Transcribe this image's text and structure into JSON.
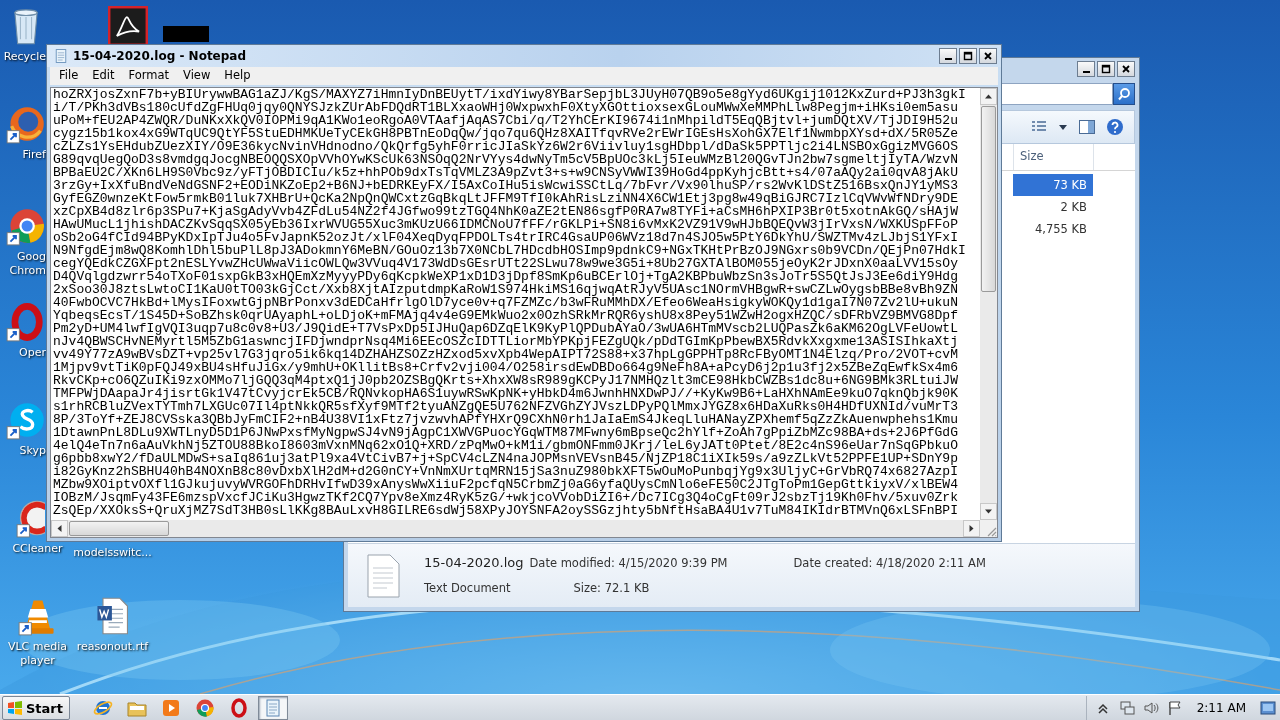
{
  "desktop": {
    "icons": [
      {
        "kind": "recycle",
        "label": "Recycle",
        "shortcut": false
      },
      {
        "kind": "acrobat",
        "shortcut": false
      },
      {
        "kind": "blank",
        "shortcut": false
      },
      {
        "kind": "firefox",
        "label": "Firef",
        "shortcut": true
      },
      {
        "kind": "chrome",
        "label": "Goog\nChrom",
        "shortcut": true
      },
      {
        "kind": "opera",
        "label": "Oper",
        "shortcut": true
      },
      {
        "kind": "skype",
        "label": "Skyp",
        "shortcut": true
      },
      {
        "kind": "ccleaner",
        "label": "CCleaner",
        "shortcut": true
      },
      {
        "kind": "none",
        "label": "modelsswitc..."
      },
      {
        "kind": "vlc",
        "label": "VLC media player",
        "shortcut": true
      },
      {
        "kind": "word",
        "label": "reasonout.rtf",
        "shortcut": false
      }
    ]
  },
  "explorer": {
    "columns": [
      {
        "label": "Size"
      }
    ],
    "rows": [
      {
        "size": "73 KB",
        "selected": true
      },
      {
        "size": "2 KB",
        "selected": false
      },
      {
        "size": "4,755 KB",
        "selected": false
      }
    ],
    "details": {
      "name": "15-04-2020.log",
      "date_modified": "Date modified: 4/15/2020 9:39 PM",
      "date_created": "Date created: 4/18/2020 2:11 AM",
      "type": "Text Document",
      "size": "Size: 72.1 KB"
    }
  },
  "notepad": {
    "title": "15-04-2020.log - Notepad",
    "menu": [
      "File",
      "Edit",
      "Format",
      "View",
      "Help"
    ],
    "lines": [
      "hoZRXjosZxnF7b+yBIUrywwBAG1aZJ/KgS/MAXYZ7iHmnIyDnBEUytT/ixdYiwy8YBarSepjbL3JUyH07QB9o5e8gYyd6UKgij1012KxZurd+PJ3h3gkI",
      "i/T/PKh3dVBs180cUfdZgFHUq0jqy0QNYSJzkZUrAbFDQdRT1BLXxaoWHj0WxpwxhF0XtyXGOttioxsexGLouMWwXeMMPhLlw8Pegjm+iHKsi0em5asu",
      "uPoM+fEU2AP4ZWQR/DuNKxXkQV0IOPMi9qA1KWo1eoRgoA0VTAafjAqAS7Cbi/q/T2YhCErKI9674i1nMhpildT5EqQBjtvl+jumDQtXV/TjJDI9H52u",
      "cygz15b1kox4xG9WTqUC9QtYF5StuEDHMKUeTyCEkGH8PBTnEoDqQw/jqo7qu6QHz8XAITfqvRVe2rEWrIGEsHsXohGX7Elf1NwmbpXYsd+dX/5R05Ze",
      "cZLZs1YsEHdubZUezXIY/O9E36kycNvinVHdnodno/QkQrfg5yhF0rricJIaSkYz6W2r6Viivluy1sgHDbpl/dDaSk5PPTljc2i4LNSBOxGgizMVG6OS",
      "G89qvqUegQoD3s8vmdgqJocgNBEOQQSXOpVVhOYwKScUk63NSOqQ2NrVYys4dwNyTm5cV5BpUOc3kLj5IeuWMzBl20QGvTJn2bw7sgmeltjIyTA/WzvN",
      "BPBaEU2C/XKn6LH9S0Vbc9z/yFTjOBDICIu/k5z+hhPOb9dxTsTqVMLZ3A9pZvt3+s+w9CNSyVWWI39HoGd4ppKyhjcBtt+s4/07aAQy2ai0qvA8jAkU",
      "3rzGy+IxXfuBndVeNdGSNF2+EODiNKZoEp2+B6NJ+bEDRKEyFX/I5AxCoIHu5isWcwiSSCtLq/7bFvr/Vx90lhuSP/rs2WvKlDStZ516BsxQnJY1yMS3",
      "GyfEGZ0wnzeKtFow5rmkB01luk7XHBrU+QcKa2NpQnQWCxtzGqBkqLtJFFM9TfI0kAhRisLziNN4X6CW1Etj3pg8w49qBiGJRC7IzlCqVWvWfNDry9DE",
      "xzCpXB4d8zlr6p3SPu7+KjaSgAdyVvb4ZFdLu54NZ2f4JGfwo99tzTGQ4NhK0aZE2tEN86sgfP0RA7w8TYFi+aCsMH6hPXIP3Br0t5xotnAkGQ/sHAjW",
      "HAwUMucL1jhishDACZKvSqqSX05yEb36IxrWVUG55Xuc3mKUzU66IDMCNoU7fFF/rGKLPi+SN8i6vMxK2VZ91V9wHJbBQEQvW3jIrVxsN/WXKUSpFFoP",
      "oSb2oG4fCId94BPyKDxIpTJu4o5FvJapnK52ozJt/xlF04XeqDyqFPDOLTs4trIRC4GsaUP06WVz18d7n4SJO5w5PtY6DkYhU/SWZTMv4zLJbjS1YFxI",
      "N9NfgdEjm8wQ8KomhlDhl5buPlL8pJ3ADokmnY6MeBN/GOuOz13b7X0NCbL7HDcdbHOSImp9pdnkC9+NGxTKHtPrBzOJ9NGxrs0b9VCDn/QEjPn07HdkI",
      "cegYQEdkCZGXFpt2nESLYvwZHcUWwaViicOWLQw3VVuq4V173WdDsGEsrUTt22SLwu78w9we3G5i+8Ub27GXTAlBOM055jeOyK2rJDxnX0aaLVV15sOy",
      "D4QVqlgdzwrr54oTXoF01sxpGkB3xHQEmXzMyyyPDy6qKcpkWeXP1xD1D3jDpf8SmKp6uBCErlOj+TgA2KBPbuWbzSn3sJoTr5S5QtJsJ3Ee6diY9Hdg",
      "2xSoo30J8ztsLwtoCI1KaU0tTO03kGjCct/Xxb8XjtAIzputdmpKaRoW1S974HkiMS16qjwqAtRJyV5UAsc1NOrmVHBgwR+swCZLwOygsbBBe8vBh9ZN",
      "40FwbOCVC7HkBd+lMysIFoxwtGjpNBrPonxv3dEDCaHfrlgOlD7yce0v+q7FZMZc/b3wFRuMMhDX/Efeo6WeaHsigkyWOKQy1d1gaI7N07Zv2lU+ukuN",
      "YqbeqsEcsT/1S45D+SoBZhsk0qrUAyaphL+oLDjoK+mFMAjq4v4eG9EMkWuo2x0OzhSRkMrRQR6yshU8x8Pey51WZwH2ogxHZQC/sDFRbVZ9BMVG8Dpf",
      "Pm2yD+UM4lwfIgVQI3uqp7u8c0v8+U3/J9QidE+T7VsPxDp5IJHuQap6DZqElK9KyPlQPDubAYaO/3wUA6HTmMVscb2LUQPasZk6aKM62OgLVFeUowtL",
      "nJv4QBWSCHvNEMyrtl5M5ZbG1aswncjIFDjwndprNsq4Mi6EEcOSZcIDTTLiorMbYPKpjFEZgUQk/pDdTGImKpPbewBX5RdvkXxgxme13ASISIhkaXtj",
      "vv49Y77zA9wBVsDZT+vp25vl7G3jqro5ik6kq14DZHAHZSOZzHZxod5xvXpb4WepAIPT72S88+x37hpLgGPPHTp8RcFByOMT1N4Elzq/Pro/2VOT+cvM",
      "1Mjpv9vtTiK0pFQJ49xBU4sHfuJiGx/y9mhU+OKllitBs8+Crfv2vji004/O258irsdEwDBDo664g9NeFh8A+aPcyD6j2p1u3fj2x5ZBeZqEwfkSx4m6",
      "RkvCKp+cO6QZuIKi9zxOMMo7ljGQQ3qM4ptxQ1jJ0pb2OZSBgQKrts+XhxXW8sR989gKCPyJ17NMHQzlt3mCE98HkbCWZBs1dc8u+6NG9BMk3RLtuiJW",
      "TMFPWjDAapaJr4jisrtGk1V47tCvyjcrEk5CB/RQNvkopHA6S1uywRSwKpNK+yHbkD4m6JwnhHNXDwPJ//+KyKw9B6+LaHXhNAmEe9kuO7qknQbjk90K",
      "s1rhRCBluZVexTYTmh7LXGUc07Il4ptNkkQR5sfXyf9MTf2tyuANZgQE5U762NFZVGhZYJVszLDPyPQlMmxJYGZ8x6HDaXuRks0H4HDfUXNId/vuMrT3",
      "8P/3ToYf+ZEJ8CVSska3QBbJyFmCIF2+nB4U38VI1xFtz7jvzwvhAPfYHXrQ9CXhN0rh1JaIaEmS4JkeqLluHANayZPXhemf5qZzZkAuenwphehs1Kmu",
      "1DtawnPnL8DLu9XWTLnyD5D1P6JNwPxsfMyNgpwSJ4vN9jAgpC1XWVGPuocYGqWTM87MFwny6mBpseQc2hYlf+ZoAh7gPpiZbMZc98BA+ds+2J6PfGdG",
      "4elQ4eTn7n6aAuVkhNj5ZTOU88BkoI8603mVxnMNq62xO1Q+XRD/zPqMwO+kM1i/gbmONFmm0JKrj/leL6yJATt0Ptet/8E2c4nS96eUar7nSqGPbkuO",
      "g6pbb8xwY2/fDaULMDwS+saIq861uj3atPl9xa4VtCivB7+j+SpCV4cLZN4naJOPMsnVEVsnB45/NjZP18C1iXIk59s/a9zZLkVt52PPFE1UP+SDnY9p",
      "i82GyKnz2hSBHU40hB4NOXnB8c80vDxbXlH2dM+d2G0nCY+VnNmXUrtqMRN15jSa3nuZ980bkXFT5wOuMoPunbqjYg9x3UljyC+GrVbRQ74x6827AzpI",
      "MZbw9XOiptvOXfl1GJkujuvyWVRGOFhDRHvIfwD39xAnysWwXiiuF2pcfqN5CrbmZj0aG6yfaQUysCmNlo6eFE50C2JTgToPm1GepGttkiyxV/xlBEW4",
      "IOBzM/JsqmFy43FE6mzspVxcfJCiKu3HgwzTKf2CQ7Ypv8eXmz4RyK5zG/+wkjcoVVobDiZI6+/Dc7ICg3Q4oCgFt09rJ2sbzTj19Kh0Fhv/5xuv0Zrk",
      "ZsQEp/XXOksS+QruXjMZ7SdT3HB0sLlKKg8BAuLxvH8GILRE6sdWj58XPyJOYSNFA2oySSGzjhty5bNftHsaBA4U1v7TuM84IKIdrBTMVnQ6xLSFnBPI"
    ]
  },
  "taskbar": {
    "start": "Start",
    "apps": [
      {
        "kind": "ie",
        "selected": false
      },
      {
        "kind": "folder",
        "selected": false
      },
      {
        "kind": "media",
        "selected": false
      },
      {
        "kind": "chrome",
        "selected": false
      },
      {
        "kind": "opera",
        "selected": false
      },
      {
        "kind": "notepad",
        "selected": true
      }
    ],
    "clock": "2:11 AM"
  }
}
